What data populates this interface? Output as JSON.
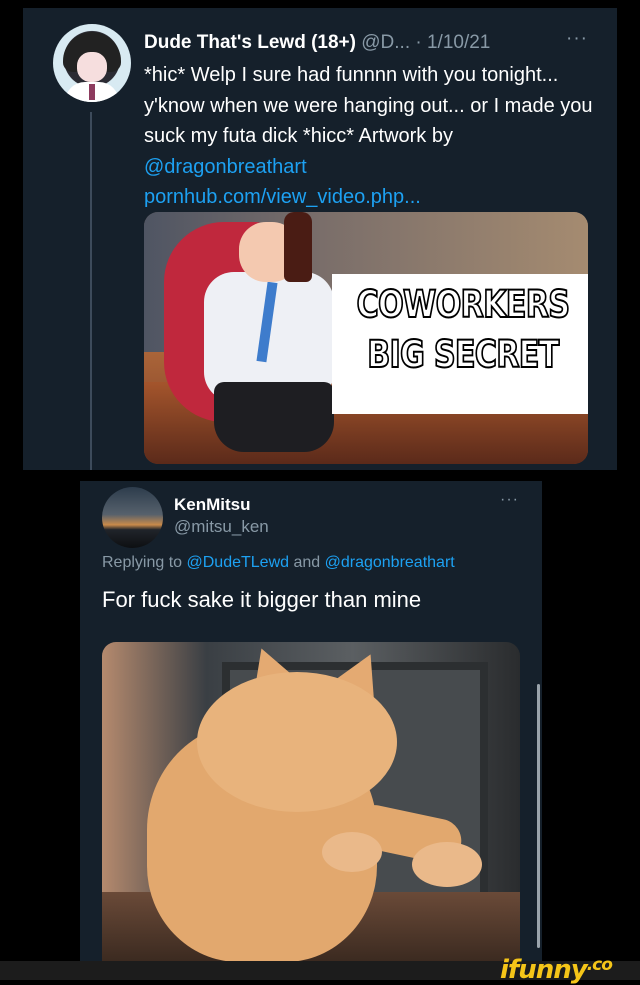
{
  "tweet1": {
    "name": "Dude That's Lewd (18+)",
    "meta": "@D... · 1/10/21",
    "more": "···",
    "body_text": "*hic* Welp I sure had funnnn with you tonight... y'know when we were hanging out... or I made you suck my futa dick *hicc* Artwork by ",
    "mention": "@dragonbreathart",
    "link": "pornhub.com/view_video.php...",
    "media_caption_line1": "COWORKERS",
    "media_caption_line2": "BIG SECRET"
  },
  "tweet2": {
    "name": "KenMitsu",
    "handle": "@mitsu_ken",
    "more": "···",
    "replying_prefix": "Replying to ",
    "reply_mention1": "@DudeTLewd",
    "reply_and": " and ",
    "reply_mention2": "@dragonbreathart",
    "text": "For fuck sake it bigger than mine"
  },
  "watermark": {
    "text": "ifunny",
    "suffix": ".co"
  },
  "colors": {
    "background": "#000000",
    "card": "#15202b",
    "link": "#1da1f2",
    "muted": "#8899a6",
    "watermark": "#f5c518"
  }
}
